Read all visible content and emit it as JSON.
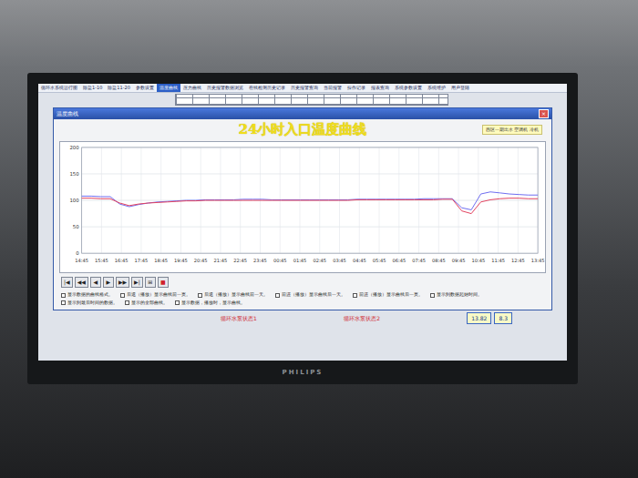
{
  "menu": [
    {
      "label": "循环水系统运行图",
      "selected": false
    },
    {
      "label": "除盐1-10",
      "selected": false
    },
    {
      "label": "除盐11-20",
      "selected": false
    },
    {
      "label": "参数设置",
      "selected": false
    },
    {
      "label": "温度曲线",
      "selected": true
    },
    {
      "label": "压力曲线",
      "selected": false
    },
    {
      "label": "历史报警数据浏览",
      "selected": false
    },
    {
      "label": "在线检测历史记录",
      "selected": false
    },
    {
      "label": "历史报警查询",
      "selected": false
    },
    {
      "label": "当前报警",
      "selected": false
    },
    {
      "label": "操作记录",
      "selected": false
    },
    {
      "label": "报表查询",
      "selected": false
    },
    {
      "label": "系统参数设置",
      "selected": false
    },
    {
      "label": "系统维护",
      "selected": false
    },
    {
      "label": "用户登陆",
      "selected": false
    }
  ],
  "dialog": {
    "title": "温度曲线",
    "close": "×"
  },
  "chart": {
    "title": "24小时入口温度曲线",
    "legend": "西区一期出水 空调机 冷机",
    "y_ticks": [
      "200",
      "150",
      "100",
      "50",
      "0"
    ],
    "x_ticks": [
      "14:45",
      "15:45",
      "16:45",
      "17:45",
      "18:45",
      "19:45",
      "20:45",
      "21:45",
      "22:45",
      "23:45",
      "00:45",
      "01:45",
      "02:45",
      "03:45",
      "04:45",
      "05:45",
      "06:45",
      "07:45",
      "08:45",
      "09:45",
      "10:45",
      "11:45",
      "12:45",
      "13:45"
    ],
    "series": [
      {
        "color": "#6d6cf0",
        "values": [
          108,
          108,
          107,
          107,
          93,
          88,
          92,
          95,
          97,
          98,
          99,
          100,
          100,
          101,
          101,
          101,
          101,
          102,
          102,
          102,
          101,
          101,
          101,
          101,
          101,
          101,
          101,
          101,
          101,
          102,
          102,
          102,
          102,
          102,
          102,
          102,
          103,
          103,
          103,
          103,
          86,
          82,
          112,
          116,
          114,
          112,
          111,
          110,
          110
        ]
      },
      {
        "color": "#e2405c",
        "values": [
          104,
          104,
          103,
          103,
          95,
          90,
          93,
          95,
          96,
          97,
          98,
          99,
          99,
          100,
          100,
          100,
          100,
          100,
          100,
          100,
          100,
          100,
          100,
          100,
          100,
          100,
          100,
          100,
          100,
          101,
          101,
          101,
          101,
          101,
          101,
          101,
          101,
          101,
          102,
          102,
          80,
          75,
          97,
          101,
          103,
          104,
          104,
          103,
          103
        ]
      }
    ]
  },
  "controls": [
    {
      "glyph": "|◀",
      "color": "#222222"
    },
    {
      "glyph": "◀◀",
      "color": "#222222"
    },
    {
      "glyph": "◀",
      "color": "#222222"
    },
    {
      "glyph": "▶",
      "color": "#222222"
    },
    {
      "glyph": "▶▶",
      "color": "#222222"
    },
    {
      "glyph": "▶|",
      "color": "#222222"
    },
    {
      "glyph": "⊞",
      "color": "#222222"
    },
    {
      "glyph": "■",
      "color": "#d0202a"
    }
  ],
  "notes": [
    "显示数据的曲线格式。",
    "后退（播放）显示曲线前一页。",
    "后退（播放）显示曲线前一天。",
    "前进（播放）显示曲线后一天。",
    "前进（播放）显示曲线后一页。",
    "显示到数据起始时间。",
    "显示到最后时间的数据。",
    "显示的全部曲线。",
    "显示数据，播放时，显示曲线。"
  ],
  "status": [
    {
      "label": "循环水泵状态1"
    },
    {
      "label": "循环水泵状态2"
    }
  ],
  "readings": [
    "13.82",
    "8.3"
  ],
  "monitor": {
    "brand": "PHILIPS"
  }
}
